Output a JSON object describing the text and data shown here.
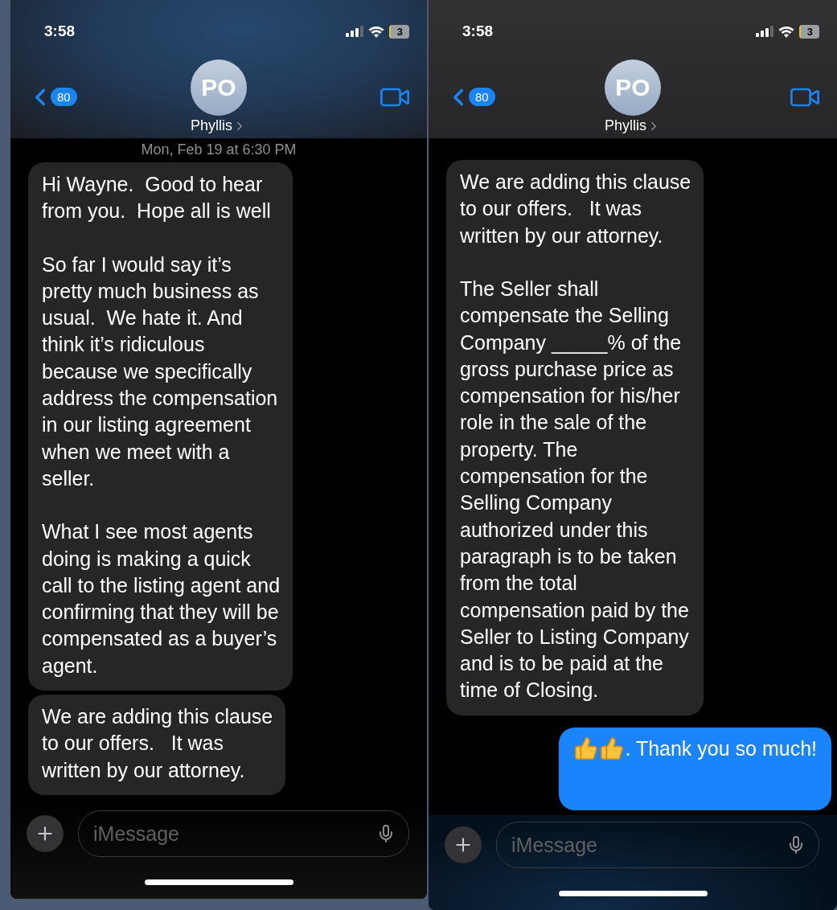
{
  "screens": [
    {
      "status": {
        "time": "3:58",
        "battery": "3"
      },
      "header": {
        "back_count": "80",
        "avatar_initials": "PO",
        "contact_name": "Phyllis"
      },
      "timestamp": "Mon, Feb 19 at 6:30 PM",
      "messages": [
        {
          "kind": "received",
          "paragraphs": [
            "Hi Wayne.  Good to hear\nfrom you.  Hope all is well",
            "So far I would say it’s\npretty much business as\nusual.  We hate it. And\nthink it’s ridiculous\nbecause we specifically\naddress the compensation\nin our listing agreement\nwhen we meet with a\nseller.",
            "What I see most agents\ndoing is making a quick\ncall to the listing agent and\nconfirming that they will be\ncompensated as a buyer’s\nagent."
          ]
        },
        {
          "kind": "received",
          "paragraphs": [
            "We are adding this clause\nto our offers.   It was\nwritten by our attorney."
          ]
        }
      ],
      "input": {
        "placeholder": "iMessage"
      }
    },
    {
      "status": {
        "time": "3:58",
        "battery": "3"
      },
      "header": {
        "back_count": "80",
        "avatar_initials": "PO",
        "contact_name": "Phyllis"
      },
      "messages": [
        {
          "kind": "received",
          "paragraphs": [
            "We are adding this clause\nto our offers.   It was\nwritten by our attorney.",
            "The Seller shall\ncompensate the Selling\nCompany _____% of the\ngross purchase price as\ncompensation for his/her\nrole in the sale of the\nproperty. The\ncompensation for the\nSelling Company\nauthorized under this\nparagraph is to be taken\nfrom the total\ncompensation paid by the\nSeller to Listing Company\nand is to be paid at the\ntime of Closing."
          ]
        },
        {
          "kind": "sent_thumbs",
          "paragraphs": [
            ". Thank you so much!"
          ]
        }
      ],
      "input": {
        "placeholder": "iMessage"
      }
    }
  ]
}
